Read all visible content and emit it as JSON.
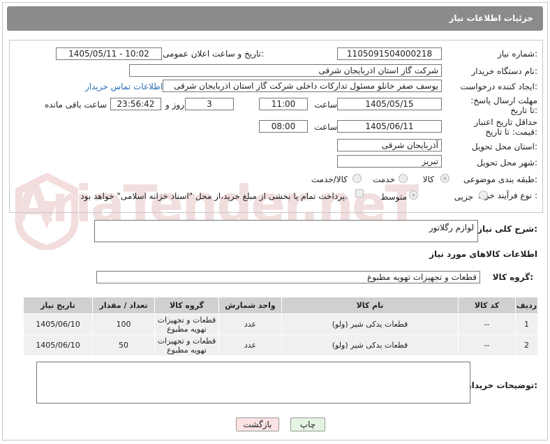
{
  "header": {
    "title": "جزئیات اطلاعات نیاز"
  },
  "form": {
    "need_number_label": "شماره نیاز:",
    "need_number": "1105091504000218",
    "announce_label": "تاریخ و ساعت اعلان عمومی:",
    "announce_value": "1405/05/11 - 10:02",
    "buyer_org_label": "نام دستگاه خریدار:",
    "buyer_org": "شرکت گاز استان اذربایجان شرقی",
    "creator_label": "ایجاد کننده درخواست:",
    "creator": "یوسف صفر خانلو  مسئول تدارکات داخلی  شرکت گاز استان اذربایجان شرقی",
    "contact_link": "اطلاعات تماس خریدار",
    "deadline_label": "مهلت ارسال پاسخ: تا تاریخ:",
    "deadline_date": "1405/05/15",
    "time_label": "ساعت",
    "deadline_time": "11:00",
    "days_value": "3",
    "days_label": "روز و",
    "remaining_value": "23:56:42",
    "remaining_label": "ساعت باقی مانده",
    "validity_label": "حداقل تاریخ اعتبار قیمت: تا تاریخ:",
    "validity_date": "1405/06/11",
    "validity_time": "08:00",
    "province_label": "استان محل تحویل:",
    "province": "آذربایجان شرقی",
    "city_label": "شهر محل تحویل:",
    "city": "تبریز",
    "category_label": "طبقه بندی موضوعی:",
    "category_options": [
      "کالا",
      "خدمت",
      "کالا/خدمت"
    ],
    "process_label": "نوع فرآیند خرید :",
    "process_options": [
      "جزیی",
      "متوسط"
    ],
    "payment_text": "پرداخت تمام یا بخشی از مبلغ خرید،از محل \"اسناد خزانه اسلامی\" خواهد بود."
  },
  "summary": {
    "label": "شرح کلی نیاز:",
    "value": "لوازم رگلاتور"
  },
  "goods": {
    "section_title": "اطلاعات کالاهای مورد نیاز",
    "group_label": "گروه کالا:",
    "group_value": "قطعات و تجهیزات تهویه مطبوع",
    "columns": [
      "ردیف",
      "کد کالا",
      "نام کالا",
      "واحد شمارش",
      "گروه کالا",
      "تعداد / مقدار",
      "تاریخ نیاز"
    ],
    "rows": [
      {
        "idx": "1",
        "code": "--",
        "name": "قطعات یدکی شیر (ولو)",
        "unit": "عدد",
        "group": "قطعات و تجهیزات تهویه مطبوع",
        "qty": "100",
        "date": "1405/06/10"
      },
      {
        "idx": "2",
        "code": "--",
        "name": "قطعات یدکی شیر (ولو)",
        "unit": "عدد",
        "group": "قطعات و تجهیزات تهویه مطبوع",
        "qty": "50",
        "date": "1405/06/10"
      }
    ]
  },
  "buyer_notes": {
    "label": "توضیحات خریدار:",
    "value": ""
  },
  "buttons": {
    "print": "چاپ",
    "back": "بازگشت"
  },
  "watermark": {
    "text": "AriaTender.neT"
  },
  "colors": {
    "header_bg": "#8b8b8b",
    "link": "#2a6fb5",
    "back_btn_bg": "#fbe3e3",
    "print_btn_bg": "#e3f5e0"
  }
}
